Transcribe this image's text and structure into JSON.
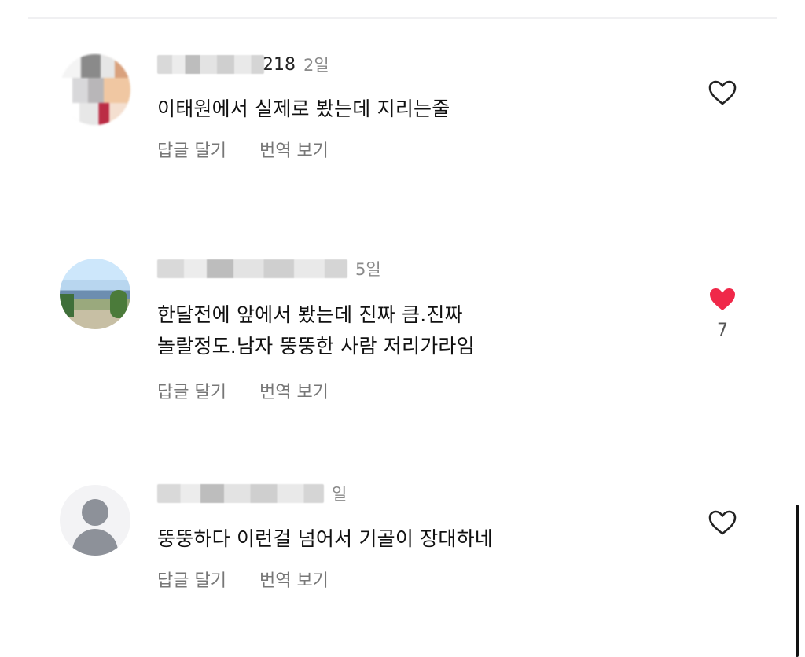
{
  "comments": [
    {
      "username_visible_suffix": "218",
      "time": "2일",
      "text_lines": [
        "이태원에서 실제로 봤는데 지리는줄"
      ],
      "reply_label": "답글 달기",
      "translate_label": "번역 보기",
      "liked": false,
      "like_count": "",
      "avatar": "blurred-photo"
    },
    {
      "username_visible_suffix": "",
      "time": "5일",
      "text_lines": [
        "한달전에  앞에서 봤는데 진짜 큼.진짜",
        "놀랄정도.남자 뚱뚱한 사람 저리가라임"
      ],
      "reply_label": "답글 달기",
      "translate_label": "번역 보기",
      "liked": true,
      "like_count": "7",
      "avatar": "blurred-landscape"
    },
    {
      "username_visible_suffix": "",
      "time": "일",
      "text_lines": [
        "뚱뚱하다 이런걸 넘어서 기골이 장대하네"
      ],
      "reply_label": "답글 달기",
      "translate_label": "번역 보기",
      "liked": false,
      "like_count": "",
      "avatar": "default-user-icon"
    }
  ],
  "icons": {
    "heart_outline": "heart-outline-icon",
    "heart_filled": "heart-filled-icon",
    "default_user": "user-icon"
  },
  "colors": {
    "like_red": "#f02849",
    "muted_text": "#777777",
    "time_text": "#8a8a8a"
  }
}
